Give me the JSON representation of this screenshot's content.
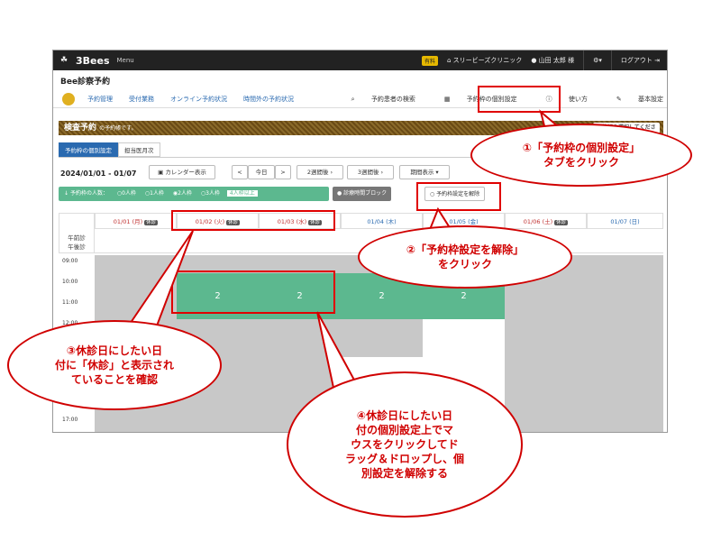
{
  "app": {
    "brand": "3Bees",
    "menu": "Menu",
    "paid_badge": "有料",
    "clinic": "スリービーズクリニック",
    "user": "山田 太郎 様",
    "logout": "ログアウト",
    "title": "Bee診察予約"
  },
  "nav": {
    "items": [
      "予約管理",
      "受付業務",
      "オンライン予約状況",
      "時間外の予約状況"
    ],
    "right": [
      "予約患者の検索",
      "予約枠の個別設定",
      "使い方",
      "基本設定"
    ]
  },
  "banner": {
    "title": "検査予約",
    "sub": "の予約帳です。",
    "select": "予約帳を選択してください"
  },
  "tabs": [
    "予約枠の個別設定",
    "担当医月次"
  ],
  "toolbar": {
    "range": "2024/01/01 - 01/07",
    "calendar": "カレンダー表示",
    "prev": "<",
    "today": "今日",
    "next": ">",
    "two_weeks": "2週間後",
    "three_weeks": "3週間後",
    "period": "期間表示"
  },
  "filter": {
    "label": "予約枠の人数：",
    "opts": [
      "0人枠",
      "1人枠",
      "2人枠",
      "3人枠"
    ],
    "more": "4人枠以上",
    "block": "診療時間ブロック",
    "release": "予約枠設定を解除"
  },
  "grid": {
    "session_labels": "午前診\n午後診",
    "days": [
      {
        "label": "01/01 (月)",
        "closed": true
      },
      {
        "label": "01/02 (火)",
        "closed": true
      },
      {
        "label": "01/03 (水)",
        "closed": true
      },
      {
        "label": "01/04 (木)",
        "closed": false
      },
      {
        "label": "01/05 (金)",
        "closed": false
      },
      {
        "label": "01/06 (土)",
        "closed": true
      },
      {
        "label": "01/07 (日)",
        "closed": false
      }
    ],
    "closed_badge": "休診",
    "times": [
      "09:00",
      "10:00",
      "11:00",
      "12:00",
      "17:00"
    ],
    "slot_value": "2"
  },
  "callouts": {
    "c1": "①「予約枠の個別設定」\nタブをクリック",
    "c2": "②「予約枠設定を解除」\nをクリック",
    "c3": "③休診日にしたい日\n付に「休診」と表示され\nていることを確認",
    "c4": "④休診日にしたい日\n付の個別設定上でマ\nウスをクリックしてド\nラッグ＆ドロップし、個\n別設定を解除する"
  },
  "colors": {
    "accent": "#2a6ab0",
    "slot": "#5cb88f",
    "annotation": "#d00000"
  }
}
